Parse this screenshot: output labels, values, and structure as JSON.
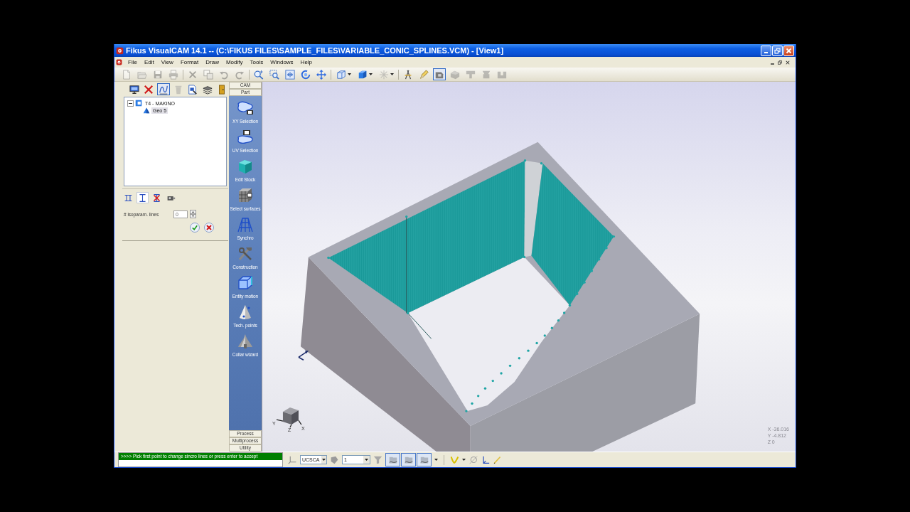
{
  "window": {
    "title": "Fikus VisualCAM 14.1 -- (C:\\FIKUS FILES\\SAMPLE_FILES\\VARIABLE_CONIC_SPLINES.VCM) - [View1]"
  },
  "menu": [
    "File",
    "Edit",
    "View",
    "Format",
    "Draw",
    "Modify",
    "Tools",
    "Windows",
    "Help"
  ],
  "toolbar": {
    "groups": [
      [
        {
          "kind": "button",
          "disabled": true,
          "selected": false
        },
        {
          "kind": "button",
          "disabled": true,
          "selected": false
        },
        {
          "kind": "button",
          "disabled": true,
          "selected": false
        },
        {
          "kind": "button",
          "disabled": true,
          "selected": false
        }
      ],
      [
        {
          "kind": "button",
          "disabled": true,
          "selected": false
        },
        {
          "kind": "button",
          "disabled": true,
          "selected": false
        },
        {
          "kind": "button",
          "disabled": true,
          "selected": false
        },
        {
          "kind": "button",
          "disabled": true,
          "selected": false
        }
      ],
      [
        {
          "kind": "button",
          "disabled": false,
          "selected": false
        },
        {
          "kind": "button",
          "disabled": false,
          "selected": false
        },
        {
          "kind": "button",
          "disabled": false,
          "selected": false
        },
        {
          "kind": "button",
          "disabled": false,
          "selected": false
        },
        {
          "kind": "button",
          "disabled": false,
          "selected": false
        }
      ],
      [
        {
          "kind": "split",
          "disabled": false,
          "selected": false
        },
        {
          "kind": "split",
          "disabled": false,
          "selected": false
        },
        {
          "kind": "split",
          "disabled": true,
          "selected": false
        }
      ],
      [
        {
          "kind": "button",
          "disabled": false,
          "selected": false
        },
        {
          "kind": "button",
          "disabled": false,
          "selected": false
        },
        {
          "kind": "button",
          "disabled": false,
          "selected": true
        },
        {
          "kind": "button",
          "disabled": true,
          "selected": false
        },
        {
          "kind": "button",
          "disabled": true,
          "selected": false
        },
        {
          "kind": "button",
          "disabled": true,
          "selected": false
        },
        {
          "kind": "button",
          "disabled": true,
          "selected": false
        }
      ]
    ]
  },
  "browser": {
    "toolbar": [
      {
        "disabled": false,
        "selected": false
      },
      {
        "disabled": false,
        "selected": false
      },
      {
        "disabled": false,
        "selected": true
      },
      {
        "disabled": true,
        "selected": false
      },
      {
        "disabled": false,
        "selected": false
      },
      {
        "disabled": false,
        "selected": false
      },
      {
        "disabled": false,
        "selected": false
      }
    ],
    "tree": [
      {
        "label": "T4 - MAKINO",
        "expanded": true,
        "selected": false,
        "children": [
          {
            "label": "Geo 5",
            "selected": true
          }
        ]
      }
    ]
  },
  "options": {
    "modes": [
      {
        "selected": false
      },
      {
        "selected": true
      },
      {
        "selected": false
      },
      {
        "selected": false
      }
    ],
    "isoparam": {
      "label": "# isoparam. lines",
      "value": "0"
    }
  },
  "sidebar": {
    "groups_top": [
      "CAM",
      "Part"
    ],
    "items": [
      "XY Selection",
      "UV Selection",
      "Edit Stock",
      "Select surfaces",
      "Synchro",
      "Construction",
      "Entity motion",
      "Tech. points",
      "Collar wizard"
    ],
    "groups_bottom": [
      "Process",
      "Multiprocess",
      "Utility"
    ]
  },
  "view": {
    "axis_labels": [
      "Y",
      "Z",
      "X"
    ],
    "coordinates": [
      "X -36.016",
      "Y -4.812",
      "Z 0"
    ]
  },
  "command_line": {
    "message": ">>>> Pick first point to change sincro lines or press enter to accept"
  },
  "status_toolbar": {
    "ucs_value": "UCSCA",
    "layer_value": "1",
    "snaps": [
      {
        "selected": true
      },
      {
        "selected": true
      },
      {
        "selected": true
      }
    ]
  }
}
